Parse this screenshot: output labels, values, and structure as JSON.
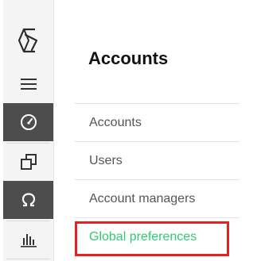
{
  "sidebar": {
    "logo_icon": "brand-logo-icon",
    "items": [
      {
        "icon": "menu-icon",
        "active": false
      },
      {
        "icon": "dashboard-gauge-icon",
        "active": true
      },
      {
        "icon": "copy-windows-icon",
        "active": false
      },
      {
        "icon": "omega-icon",
        "active": true
      },
      {
        "icon": "bar-chart-icon",
        "active": false
      }
    ]
  },
  "panel": {
    "title": "Accounts",
    "menu": [
      {
        "label": "Accounts",
        "active": false
      },
      {
        "label": "Users",
        "active": false
      },
      {
        "label": "Account managers",
        "active": false
      },
      {
        "label": "Global preferences",
        "active": true
      }
    ]
  },
  "colors": {
    "rail_active": "#4d4d4d",
    "menu_active": "#2ecc71",
    "highlight_border": "#e32222"
  }
}
